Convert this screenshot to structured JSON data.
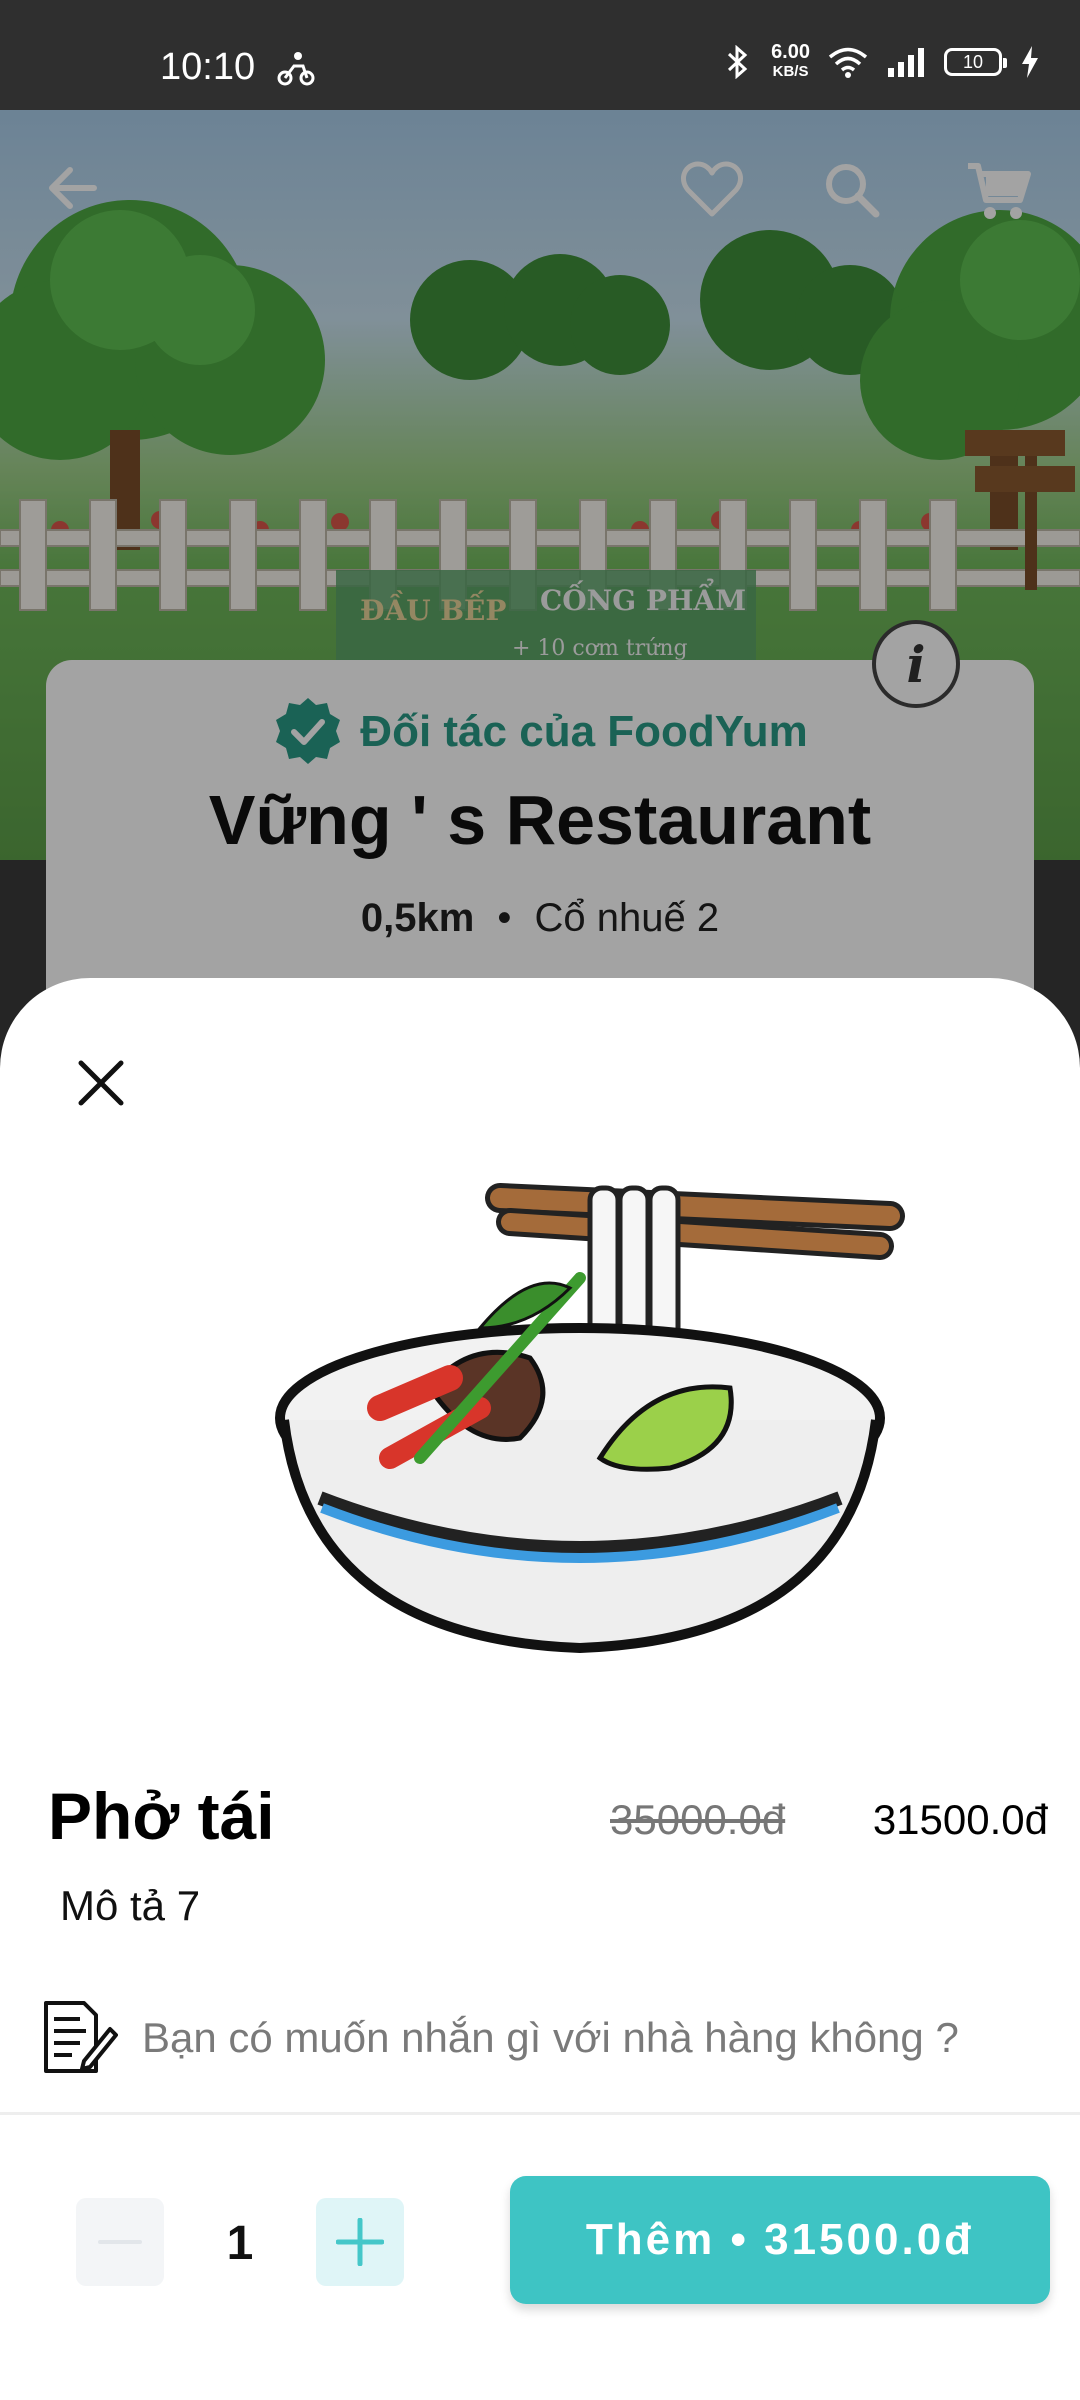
{
  "status_bar": {
    "time": "10:10",
    "net_speed": "6.00",
    "net_unit": "KB/S",
    "battery": "10"
  },
  "banner": {
    "sign_left": "ĐẦU BẾP",
    "sign_right": "CỐNG PHẨM",
    "sign_sub": "+ 10 cơm trứng"
  },
  "restaurant": {
    "partner_label": "Đối tác của FoodYum",
    "name": "Vững ' s Restaurant",
    "distance": "0,5km",
    "separator": "•",
    "address": "Cổ nhuế 2"
  },
  "dish": {
    "name": "Phở tái",
    "old_price": "35000.0đ",
    "price": "31500.0đ",
    "description": "Mô tả 7",
    "note_placeholder": "Bạn có muốn nhắn gì với nhà hàng không ?"
  },
  "cart": {
    "quantity": "1",
    "add_button_label": "Thêm • 31500.0đ"
  },
  "colors": {
    "accent": "#3ec4c4",
    "partner_green": "#2a9a86",
    "status_bar": "#2f2f2f"
  },
  "icons": [
    "back-arrow-icon",
    "heart-icon",
    "search-icon",
    "cart-icon",
    "info-icon",
    "verified-badge-icon",
    "close-icon",
    "note-edit-icon",
    "minus-icon",
    "plus-icon"
  ]
}
